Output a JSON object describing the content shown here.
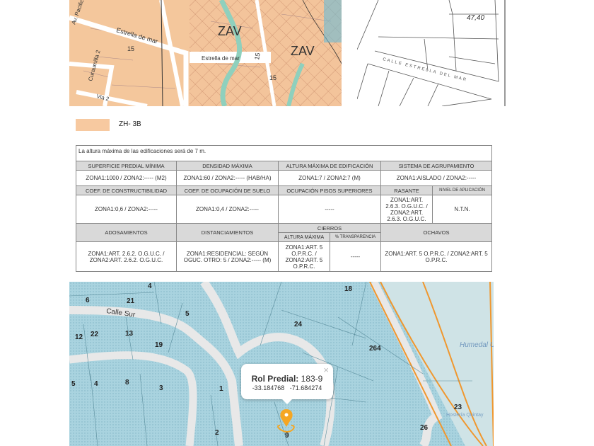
{
  "zoning_map": {
    "zone_labels": [
      "ZAV",
      "ZAV"
    ],
    "streets": [
      "Estrella de mar",
      "Estrella de mar",
      "Via 2",
      "Curaumilla 2",
      "Av. Pacifico"
    ],
    "numbers": [
      "15",
      "15",
      "15"
    ]
  },
  "plan_sketch": {
    "measure": "47,40",
    "street": "CALLE ESTRELLA DEL MAR"
  },
  "legend": {
    "color": "#f7c9a0",
    "label": "ZH- 3B"
  },
  "norms_table": {
    "note": "La altura máxima de las edificaciones será de 7 m.",
    "row1_headers": [
      "SUPERFICIE PREDIAL MÍNIMA",
      "DENSIDAD MÁXIMA",
      "ALTURA MÁXIMA DE EDIFICACIÓN",
      "SISTEMA DE AGRUPAMIENTO"
    ],
    "row1_values": [
      "ZONA1:1000 / ZONA2:----- (M2)",
      "ZONA1:60 / ZONA2:----- (HAB/HA)",
      "ZONA1:7 / ZONA2:7 (M)",
      "ZONA1:AISLADO / ZONA2:-----"
    ],
    "row2_headers": [
      "COEF. DE CONSTRUCTIBILIDAD",
      "COEF. DE OCUPACIÓN DE SUELO",
      "OCUPACIÓN PISOS SUPERIORES",
      "RASANTE",
      "NIVEL DE APLICACIÓN"
    ],
    "row2_values": [
      "ZONA1:0,6 / ZONA2:-----",
      "ZONA1:0,4 / ZONA2:-----",
      "-----",
      "ZONA1:ART. 2.6.3. O.G.U.C. / ZONA2:ART. 2.6.3. O.G.U.C.",
      "N.T.N."
    ],
    "row3_headers": [
      "ADOSAMIENTOS",
      "DISTANCIAMIENTOS",
      "CIERROS",
      "OCHAVOS"
    ],
    "cierros_subheaders": [
      "ALTURA MÁXIMA",
      "% TRANSPARENCIA"
    ],
    "row3_values": [
      "ZONA1:ART. 2.6.2. O.G.U.C. / ZONA2:ART. 2.6.2. O.G.U.C.",
      "ZONA1:RESIDENCIAL: SEGÚN OGUC. OTRO: 5 / ZONA2:----- (M)",
      "ZONA1:ART. 5 O.P.R.C. / ZONA2:ART. 5 O.P.R.C.",
      "-----",
      "ZONA1:ART. 5 O.P.R.C. / ZONA2:ART. 5 O.P.R.C."
    ]
  },
  "parcel_map": {
    "street": "Calle Sur",
    "parcels": [
      "4",
      "18",
      "6",
      "21",
      "5",
      "24",
      "12",
      "22",
      "13",
      "19",
      "264",
      "5",
      "4",
      "8",
      "3",
      "1",
      "2",
      "9",
      "23",
      "26"
    ],
    "area_label": "Humedal Urbano Estero El Jote",
    "place_label": "Hostería Quintay",
    "popup": {
      "label": "Rol Predial:",
      "value": "183-9",
      "lat": "-33.184768",
      "lon": "-71.684274",
      "close": "×"
    },
    "colors": {
      "parcel": "#a9d3df",
      "road": "#e8e8e8",
      "boundary": "#f0972e",
      "marker": "#f5a623"
    }
  }
}
